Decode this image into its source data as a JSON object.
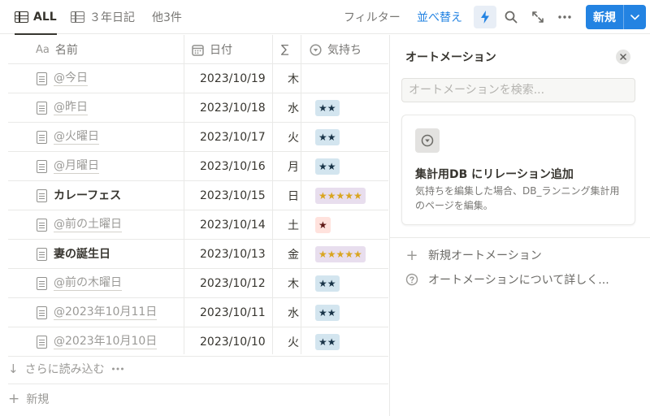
{
  "toolbar": {
    "tabs": [
      {
        "label": "ALL"
      },
      {
        "label": "３年日記"
      },
      {
        "label": "他3件"
      }
    ],
    "filter_label": "フィルター",
    "sort_label": "並べ替え",
    "new_label": "新規"
  },
  "table": {
    "headers": {
      "name": "名前",
      "name_prefix": "Aa",
      "date": "日付",
      "dow": "∑",
      "mood": "気持ち"
    },
    "rows": [
      {
        "name": "@今日",
        "date": "2023/10/19",
        "dow": "木",
        "mood": "",
        "mood_color": "",
        "bold": false
      },
      {
        "name": "@昨日",
        "date": "2023/10/18",
        "dow": "水",
        "mood": "★★",
        "mood_color": "blue",
        "bold": false
      },
      {
        "name": "@火曜日",
        "date": "2023/10/17",
        "dow": "火",
        "mood": "★★",
        "mood_color": "blue",
        "bold": false
      },
      {
        "name": "@月曜日",
        "date": "2023/10/16",
        "dow": "月",
        "mood": "★★",
        "mood_color": "blue",
        "bold": false
      },
      {
        "name": "カレーフェス",
        "date": "2023/10/15",
        "dow": "日",
        "mood": "★★★★★",
        "mood_color": "purple",
        "bold": true
      },
      {
        "name": "@前の土曜日",
        "date": "2023/10/14",
        "dow": "土",
        "mood": "★",
        "mood_color": "red",
        "bold": false
      },
      {
        "name": "妻の誕生日",
        "date": "2023/10/13",
        "dow": "金",
        "mood": "★★★★★",
        "mood_color": "purple",
        "bold": true
      },
      {
        "name": "@前の木曜日",
        "date": "2023/10/12",
        "dow": "木",
        "mood": "★★",
        "mood_color": "blue",
        "bold": false
      },
      {
        "name": "@2023年10月11日",
        "date": "2023/10/11",
        "dow": "水",
        "mood": "★★",
        "mood_color": "blue",
        "bold": false
      },
      {
        "name": "@2023年10月10日",
        "date": "2023/10/10",
        "dow": "火",
        "mood": "★★",
        "mood_color": "blue",
        "bold": false
      }
    ],
    "load_more_label": "さらに読み込む",
    "new_row_label": "新規"
  },
  "panel": {
    "title": "オートメーション",
    "search_placeholder": "オートメーションを検索...",
    "card_title": "集計用DB にリレーション追加",
    "card_description": "気持ちを編集した場合、DB_ランニング集計用のページを編集。",
    "new_automation_label": "新規オートメーション",
    "help_label": "オートメーションについて詳しく..."
  },
  "colors": {
    "accent": "#2383e2",
    "tag_blue_bg": "#d3e5ef",
    "tag_purple_bg": "#e8deee",
    "tag_red_bg": "#ffe2dd"
  }
}
